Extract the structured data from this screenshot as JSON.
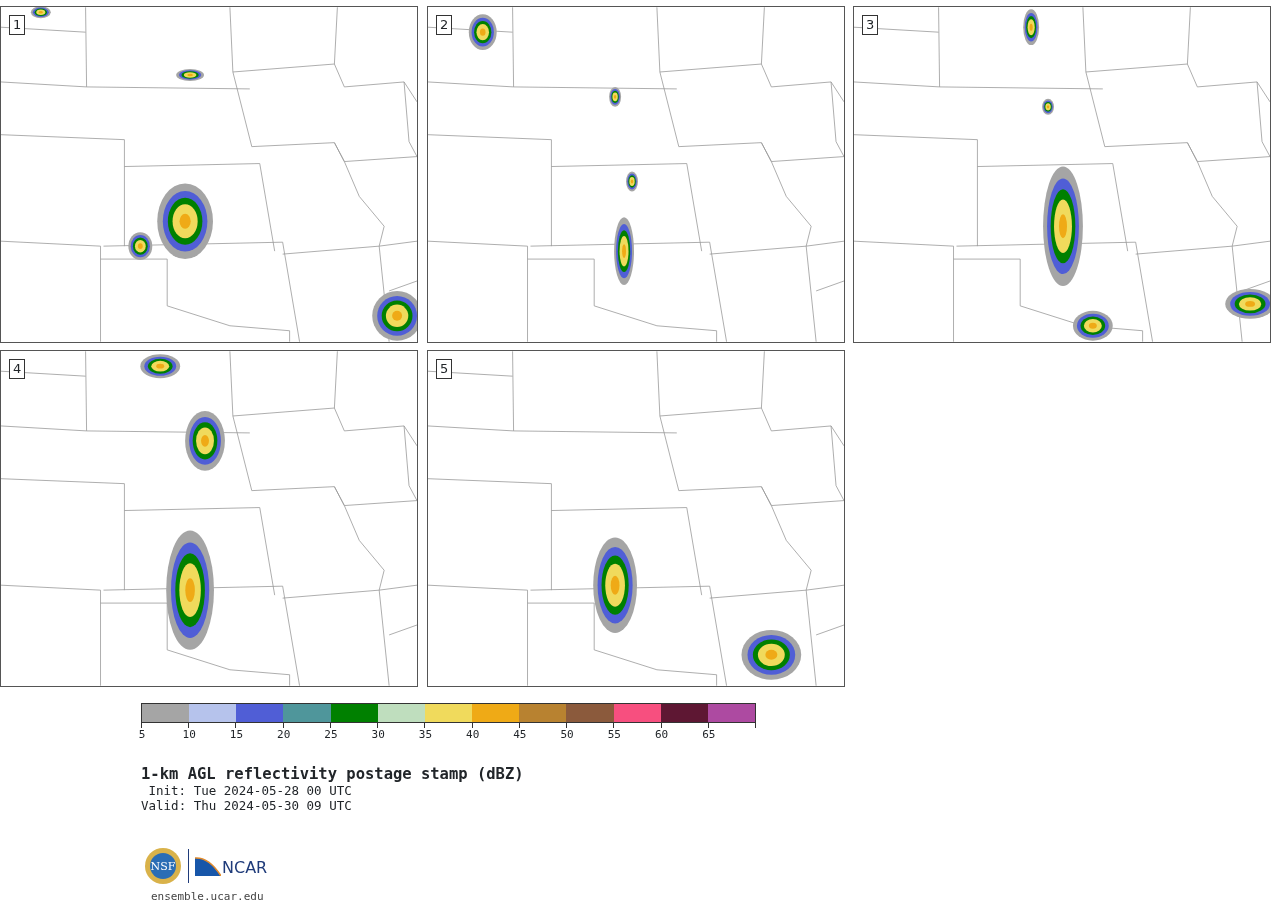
{
  "panels": [
    {
      "label": "1"
    },
    {
      "label": "2"
    },
    {
      "label": "3"
    },
    {
      "label": "4"
    },
    {
      "label": "5"
    }
  ],
  "colorbar": {
    "bins": [
      {
        "label": "5",
        "color": "#a5a5a5"
      },
      {
        "label": "10",
        "color": "#b6c3ec"
      },
      {
        "label": "15",
        "color": "#505ed6"
      },
      {
        "label": "20",
        "color": "#4f969b"
      },
      {
        "label": "25",
        "color": "#008000"
      },
      {
        "label": "30",
        "color": "#bfdebe"
      },
      {
        "label": "35",
        "color": "#f0da5c"
      },
      {
        "label": "40",
        "color": "#efaa16"
      },
      {
        "label": "45",
        "color": "#b88230"
      },
      {
        "label": "50",
        "color": "#8b5a3c"
      },
      {
        "label": "55",
        "color": "#f74f7f"
      },
      {
        "label": "60",
        "color": "#5e1733"
      },
      {
        "label": "65",
        "color": "#ad4aa1"
      }
    ]
  },
  "title": "1-km AGL reflectivity postage stamp (dBZ)",
  "init": "Init: Tue 2024-05-28 00 UTC",
  "valid": "Valid: Thu 2024-05-30 09 UTC",
  "logo": {
    "seal_text": "NSF",
    "wordmark": "NCAR"
  },
  "footer": "ensemble.ucar.edu"
}
